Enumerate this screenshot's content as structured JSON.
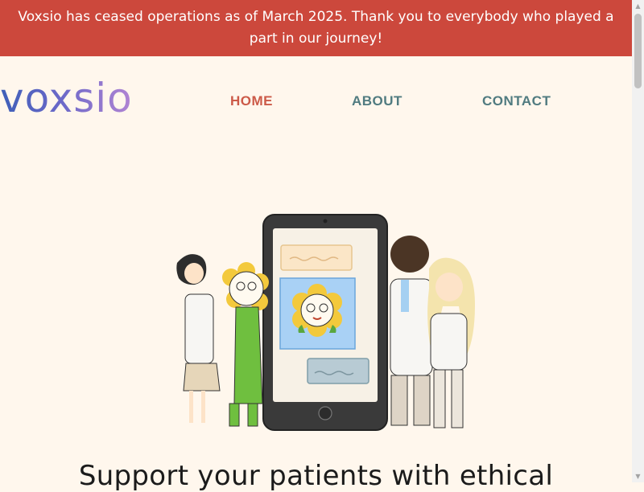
{
  "banner": {
    "message": "Voxsio has ceased operations as of March 2025. Thank you to everybody who played a part in our journey!"
  },
  "header": {
    "logo_text": "voxsio",
    "nav": {
      "home": "HOME",
      "about": "ABOUT",
      "contact": "CONTACT"
    }
  },
  "hero": {
    "headline": "Support your patients with ethical"
  },
  "colors": {
    "banner_bg": "#cc483c",
    "page_bg": "#fff7ed",
    "nav_active": "#cc5a48",
    "nav_default": "#507b80"
  }
}
